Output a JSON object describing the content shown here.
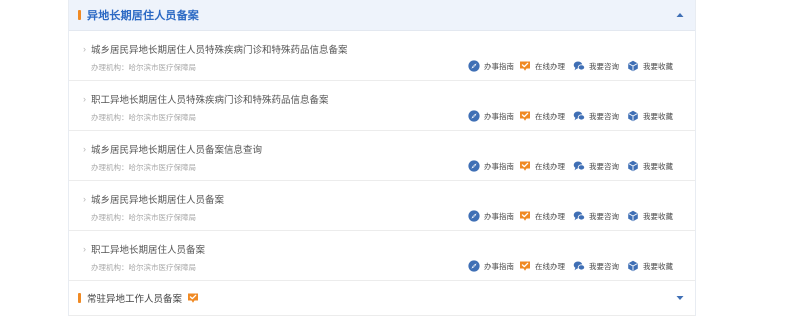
{
  "section": {
    "title": "异地长期居住人员备案"
  },
  "actions": {
    "guide": "办事指南",
    "online": "在线办理",
    "consult": "我要咨询",
    "favorite": "我要收藏"
  },
  "items": [
    {
      "title": "城乡居民异地长期居住人员特殊疾病门诊和特殊药品信息备案",
      "org": "办理机构：哈尔滨市医疗保障局"
    },
    {
      "title": "职工异地长期居住人员特殊疾病门诊和特殊药品信息备案",
      "org": "办理机构：哈尔滨市医疗保障局"
    },
    {
      "title": "城乡居民异地长期居住人员备案信息查询",
      "org": "办理机构：哈尔滨市医疗保障局"
    },
    {
      "title": "城乡居民异地长期居住人员备案",
      "org": "办理机构：哈尔滨市医疗保障局"
    },
    {
      "title": "职工异地长期居住人员备案",
      "org": "办理机构：哈尔滨市医疗保障局"
    }
  ],
  "next_section": {
    "title": "常驻异地工作人员备案"
  },
  "colors": {
    "accent_blue": "#2c6ac4",
    "icon_blue": "#3f6fb5",
    "accent_orange": "#f08a24"
  },
  "icons": [
    "chevron-up-icon",
    "compass-icon",
    "online-badge-icon",
    "chat-bubble-icon",
    "cube-icon",
    "chevron-down-icon"
  ]
}
